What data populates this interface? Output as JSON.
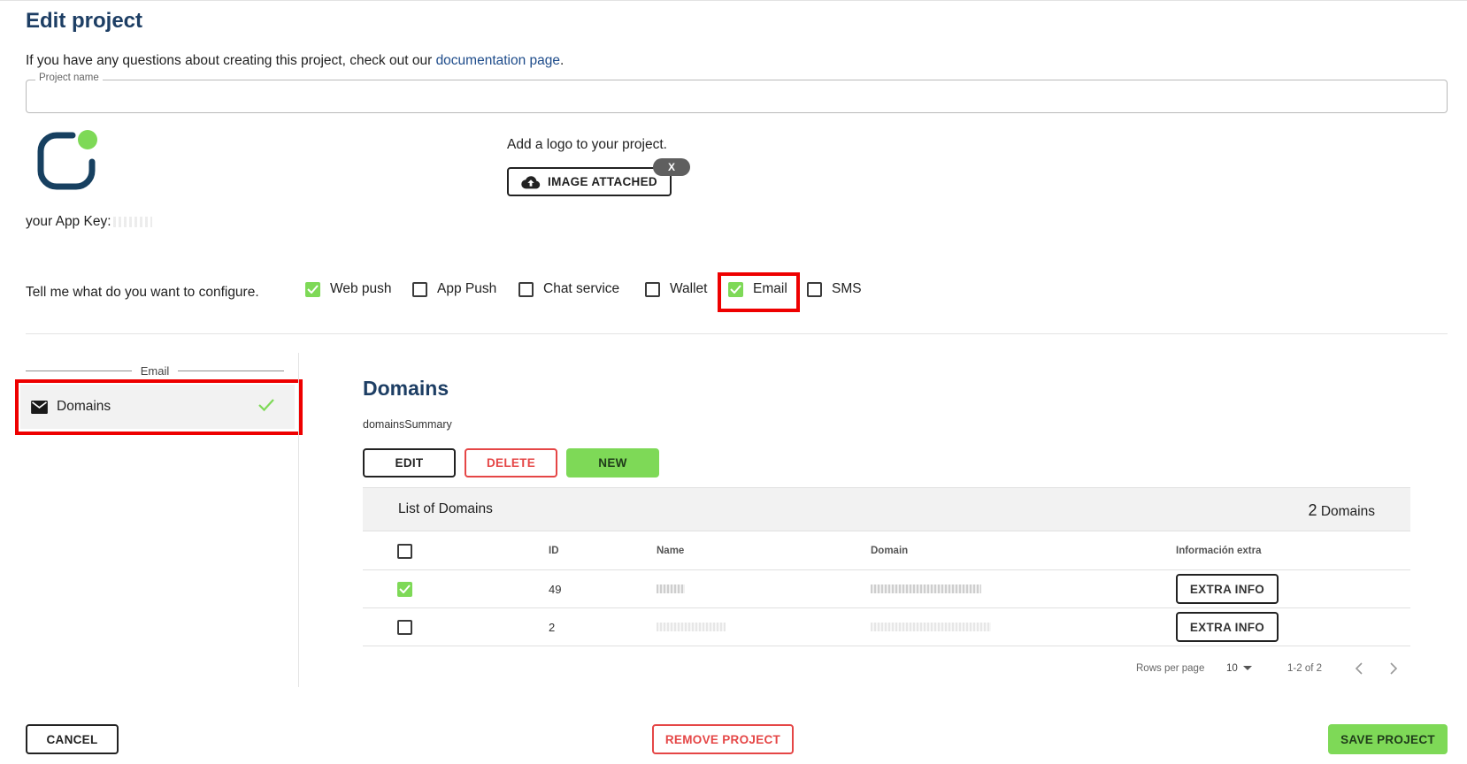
{
  "page": {
    "title": "Edit project",
    "intro_text": "If you have any questions about creating this project, check out our ",
    "intro_link": "documentation page",
    "intro_end": "."
  },
  "project_name": {
    "label": "Project name",
    "value": ""
  },
  "app_key": {
    "label": "your App Key:"
  },
  "logo": {
    "prompt": "Add a logo to your project.",
    "button_label": "IMAGE ATTACHED",
    "button_icon": "cloud-upload-icon",
    "remove_label": "X"
  },
  "configure": {
    "label": "Tell me what do you want to configure.",
    "options": [
      {
        "label": "Web push",
        "checked": true
      },
      {
        "label": "App Push",
        "checked": false
      },
      {
        "label": "Chat service",
        "checked": false
      },
      {
        "label": "Wallet",
        "checked": false
      },
      {
        "label": "Email",
        "checked": true,
        "highlighted": true
      },
      {
        "label": "SMS",
        "checked": false
      }
    ]
  },
  "sidebar": {
    "section": "Email",
    "items": [
      {
        "label": "Domains",
        "icon": "envelope-icon",
        "status_icon": "check-icon",
        "highlighted": true
      }
    ]
  },
  "domains": {
    "title": "Domains",
    "summary": "domainsSummary",
    "actions": {
      "edit": "EDIT",
      "delete": "DELETE",
      "new": "NEW"
    },
    "list_title": "List of Domains",
    "count_number": "2",
    "count_label": "Domains",
    "columns": {
      "id": "ID",
      "name": "Name",
      "domain": "Domain",
      "extra": "Información extra"
    },
    "rows": [
      {
        "checked": true,
        "id": "49",
        "extra_button": "EXTRA INFO"
      },
      {
        "checked": false,
        "id": "2",
        "extra_button": "EXTRA INFO"
      }
    ],
    "pagination": {
      "rows_per_page_label": "Rows per page",
      "rows_per_page_value": "10",
      "range": "1-2 of 2"
    }
  },
  "footer": {
    "cancel": "CANCEL",
    "remove": "REMOVE PROJECT",
    "save": "SAVE PROJECT"
  },
  "colors": {
    "title": "#1d3e64",
    "accent_green": "#7ed957",
    "danger": "#e54646",
    "highlight": "#ee0000"
  }
}
